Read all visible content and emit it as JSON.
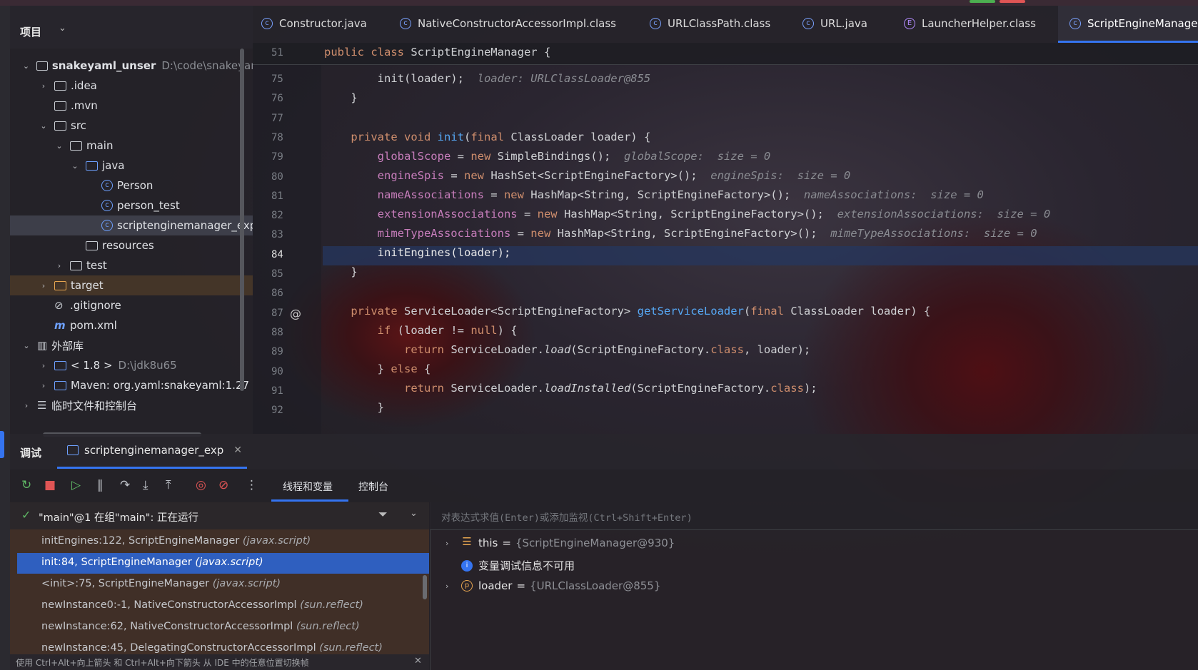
{
  "project": {
    "title": "项目"
  },
  "tabs": [
    {
      "label": "Constructor.java"
    },
    {
      "label": "NativeConstructorAccessorImpl.class"
    },
    {
      "label": "URLClassPath.class"
    },
    {
      "label": "URL.java"
    },
    {
      "label": "LauncherHelper.class"
    },
    {
      "label": "ScriptEngineManager"
    }
  ],
  "tree": {
    "root_name": "snakeyaml_unser",
    "root_path": "D:\\code\\snakeyaml",
    "idea": ".idea",
    "mvn": ".mvn",
    "src": "src",
    "main": "main",
    "java": "java",
    "person": "Person",
    "person_test": "person_test",
    "sem_exp": "scriptenginemanager_exp",
    "resources": "resources",
    "test": "test",
    "target": "target",
    "gitignore": ".gitignore",
    "pom": "pom.xml",
    "ext_libs": "外部库",
    "jdk": "< 1.8 >",
    "jdk_path": "D:\\jdk8u65",
    "maven": "Maven: org.yaml:snakeyaml:1.27",
    "scratches": "临时文件和控制台"
  },
  "editor": {
    "sticky_line": "51",
    "sticky_code": "public class ScriptEngineManager {",
    "lines": [
      "75",
      "76",
      "77",
      "78",
      "79",
      "80",
      "81",
      "82",
      "83",
      "84",
      "85",
      "86",
      "87",
      "88",
      "89",
      "90",
      "91",
      "92"
    ],
    "current_line": "84"
  },
  "debug": {
    "title": "调试",
    "session": "scriptenginemanager_exp",
    "tab_threads": "线程和变量",
    "tab_console": "控制台",
    "thread_status": "\"main\"@1 在组\"main\": 正在运行",
    "frames": [
      {
        "method": "initEngines:122, ScriptEngineManager",
        "pkg": "(javax.script)"
      },
      {
        "method": "init:84, ScriptEngineManager",
        "pkg": "(javax.script)"
      },
      {
        "method": "<init>:75, ScriptEngineManager",
        "pkg": "(javax.script)"
      },
      {
        "method": "newInstance0:-1, NativeConstructorAccessorImpl",
        "pkg": "(sun.reflect)"
      },
      {
        "method": "newInstance:62, NativeConstructorAccessorImpl",
        "pkg": "(sun.reflect)"
      },
      {
        "method": "newInstance:45, DelegatingConstructorAccessorImpl",
        "pkg": "(sun.reflect)"
      }
    ],
    "eval_placeholder": "对表达式求值(Enter)或添加监视(Ctrl+Shift+Enter)",
    "var_this_name": "this",
    "var_this_value": "{ScriptEngineManager@930}",
    "var_info": "变量调试信息不可用",
    "var_loader_name": "loader",
    "var_loader_value": "{URLClassLoader@855}",
    "footer_hint": "使用 Ctrl+Alt+向上箭头 和 Ctrl+Alt+向下箭头 从 IDE 中的任意位置切换帧"
  },
  "colors": {
    "accent": "#3574f0",
    "keyword": "#cf8e6d",
    "method": "#56a8f5",
    "field": "#c77dbb"
  }
}
